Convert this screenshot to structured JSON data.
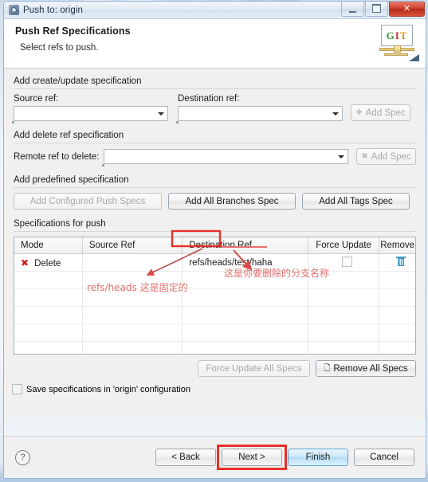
{
  "window": {
    "title": "Push to: origin",
    "icon": "push-window-icon",
    "controls": {
      "minimize": "minimize-icon",
      "maximize": "maximize-icon",
      "close": "✕"
    }
  },
  "banner": {
    "heading": "Push Ref Specifications",
    "subtitle": "Select refs to push.",
    "logo_letters": {
      "g": "G",
      "i": "I",
      "t": "T"
    }
  },
  "create_update_group": {
    "legend": "Add create/update specification",
    "source_ref_label": "Source ref:",
    "source_ref_value": "",
    "destination_ref_label": "Destination ref:",
    "destination_ref_value": "",
    "add_spec_label": "Add Spec",
    "add_spec_icon": "plus-icon",
    "add_spec_enabled": false
  },
  "delete_group": {
    "legend": "Add delete ref specification",
    "remote_ref_label": "Remote ref to delete:",
    "remote_ref_value": "",
    "add_spec_label": "Add Spec",
    "add_spec_icon": "x-icon",
    "add_spec_enabled": false
  },
  "predefined_group": {
    "legend": "Add predefined specification",
    "buttons": [
      {
        "label": "Add Configured Push Specs",
        "enabled": false
      },
      {
        "label": "Add All Branches Spec",
        "enabled": true
      },
      {
        "label": "Add All Tags Spec",
        "enabled": true
      }
    ]
  },
  "specifications_group": {
    "legend": "Specifications for push",
    "columns": [
      "Mode",
      "Source Ref",
      "Destination Ref",
      "Force Update",
      "Remove"
    ],
    "rows": [
      {
        "mode_icon": "delete-x-icon",
        "mode": "Delete",
        "source_ref": "",
        "destination_ref": "refs/heads/test/haha",
        "force_update": false,
        "remove_icon": "trash-icon"
      }
    ],
    "force_update_all_label": "Force Update All Specs",
    "force_update_all_enabled": false,
    "remove_all_label": "Remove All Specs",
    "remove_all_icon": "remove-all-icon",
    "remove_all_enabled": true
  },
  "save_option": {
    "label": "Save specifications in 'origin' configuration",
    "checked": false
  },
  "footer": {
    "help_label": "?",
    "back_label": "< Back",
    "next_label": "Next >",
    "finish_label": "Finish",
    "cancel_label": "Cancel"
  },
  "annotations": {
    "note_fixed": "refs/heads 这是固定的",
    "note_branch": "这是你要删除的分支名称",
    "highlight_color": "#e8302a",
    "note_color": "#e2706e"
  }
}
